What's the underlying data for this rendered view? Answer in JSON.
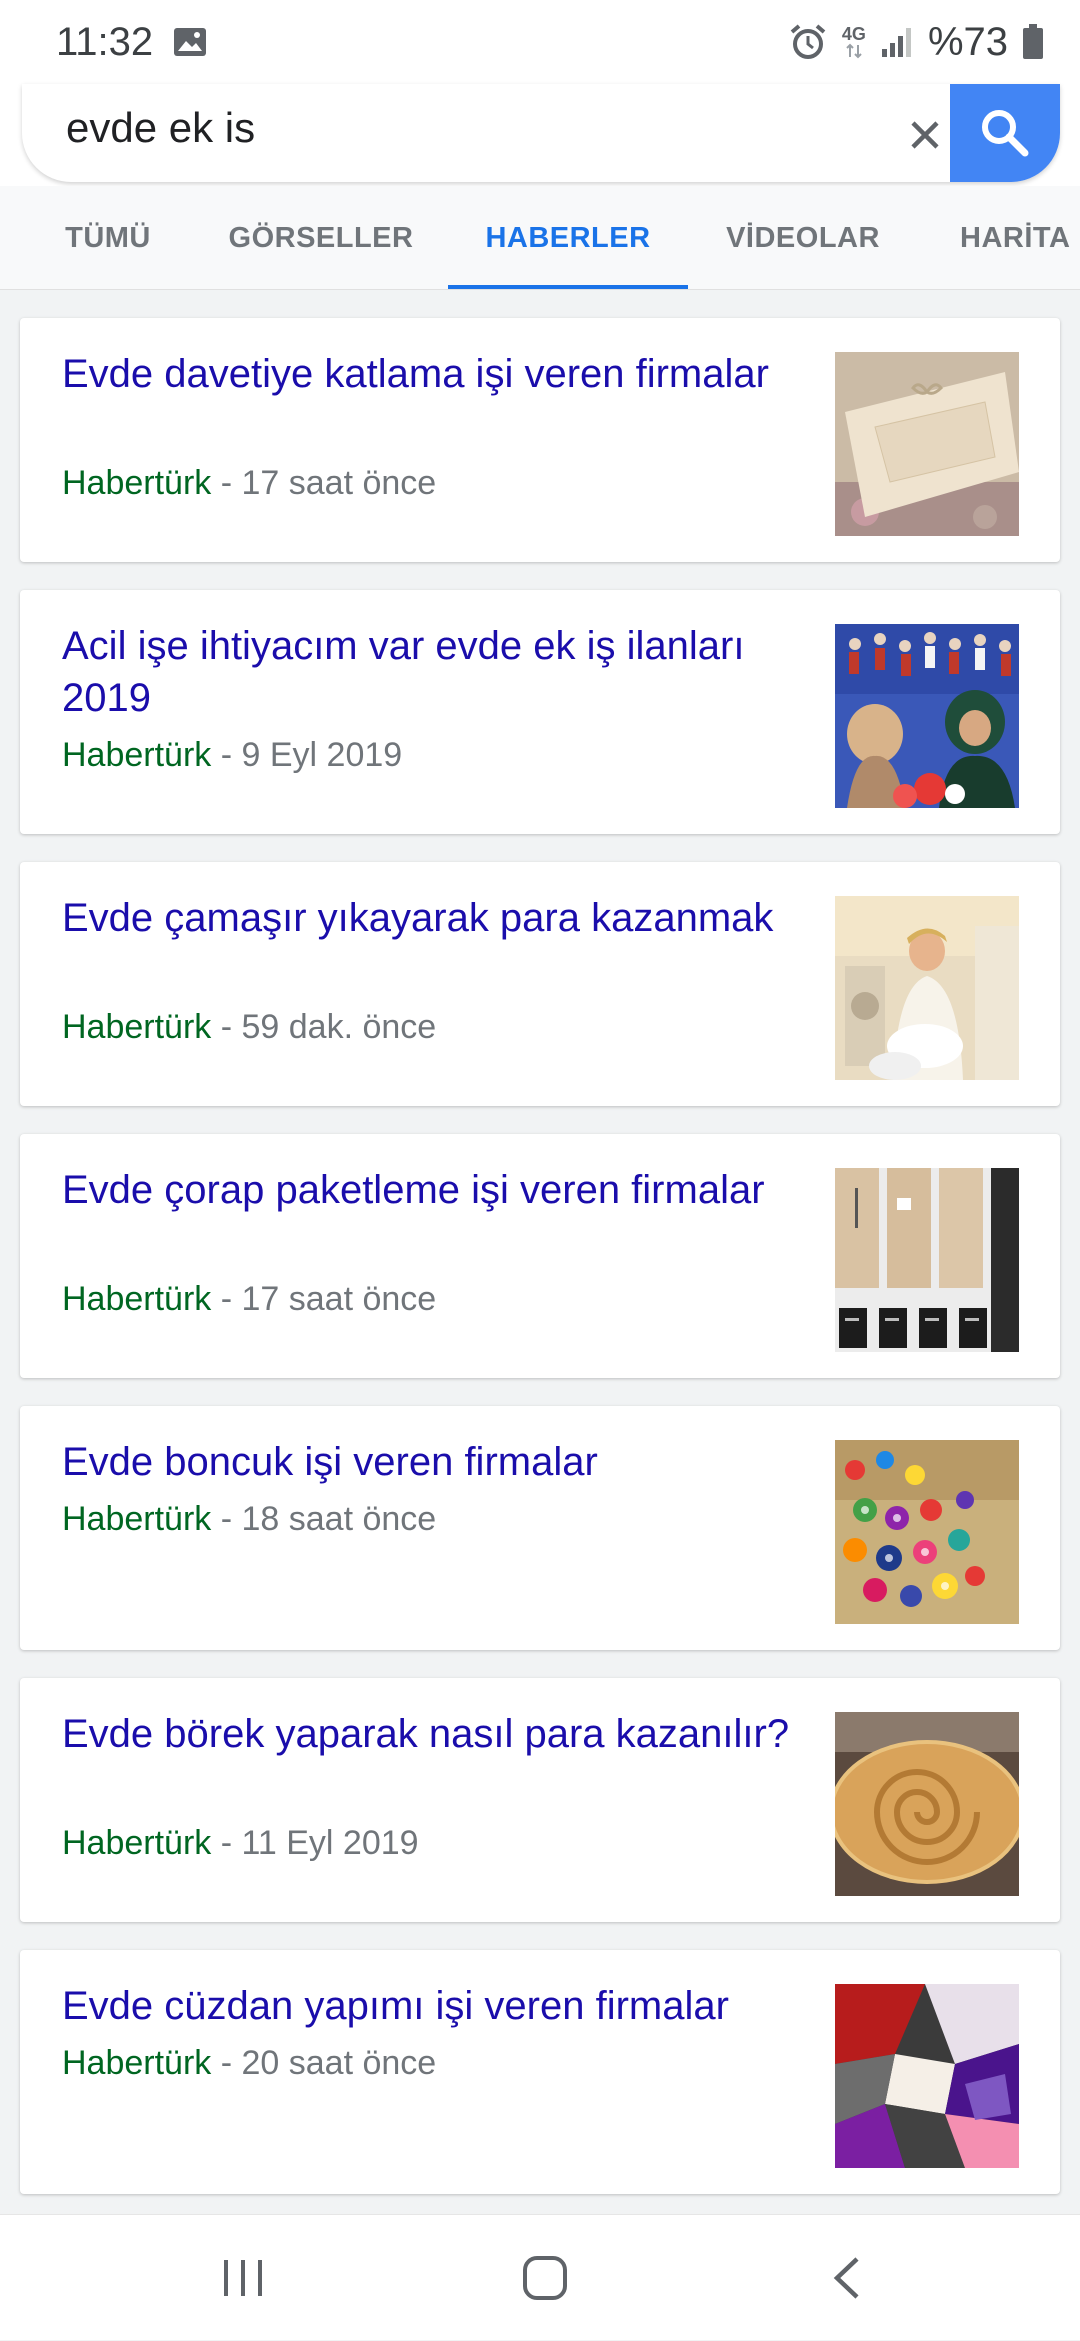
{
  "status_bar": {
    "time": "11:32",
    "network": "4G",
    "battery": "%73",
    "icons": [
      "gallery-icon",
      "alarm-icon",
      "signal-icon",
      "battery-icon"
    ]
  },
  "search": {
    "query": "evde ek is",
    "accent_color": "#4285f4"
  },
  "tabs": [
    {
      "label": "TÜMÜ",
      "active": false
    },
    {
      "label": "GÖRSELLER",
      "active": false
    },
    {
      "label": "HABERLER",
      "active": true
    },
    {
      "label": "VİDEOLAR",
      "active": false
    },
    {
      "label": "HARİTA",
      "active": false
    }
  ],
  "results": [
    {
      "title": "Evde davetiye katlama işi veren firmalar",
      "source": "Habertürk",
      "time": "17 saat önce",
      "thumb": "invitation-image"
    },
    {
      "title": "Acil işe ihtiyacım var evde ek iş ilanları 2019",
      "source": "Habertürk",
      "time": "9 Eyl 2019",
      "thumb": "women-working-image"
    },
    {
      "title": "Evde çamaşır yıkayarak para kazanmak",
      "source": "Habertürk",
      "time": "59 dak. önce",
      "thumb": "laundry-image"
    },
    {
      "title": "Evde çorap paketleme işi veren firmalar",
      "source": "Habertürk",
      "time": "17 saat önce",
      "thumb": "socks-packaging-image"
    },
    {
      "title": "Evde boncuk işi veren firmalar",
      "source": "Habertürk",
      "time": "18 saat önce",
      "thumb": "beads-image"
    },
    {
      "title": "Evde börek yaparak nasıl para kazanılır?",
      "source": "Habertürk",
      "time": "11 Eyl 2019",
      "thumb": "borek-image"
    },
    {
      "title": "Evde cüzdan yapımı işi veren firmalar",
      "source": "Habertürk",
      "time": "20 saat önce",
      "thumb": "felt-wallets-image"
    }
  ],
  "meta_separator": " - ",
  "colors": {
    "title": "#1a0dab",
    "source": "#006621",
    "meta": "#70757a",
    "active_tab": "#1a73e8"
  },
  "nav_bar": {
    "icons": [
      "recent-apps-icon",
      "home-icon",
      "back-icon"
    ]
  }
}
